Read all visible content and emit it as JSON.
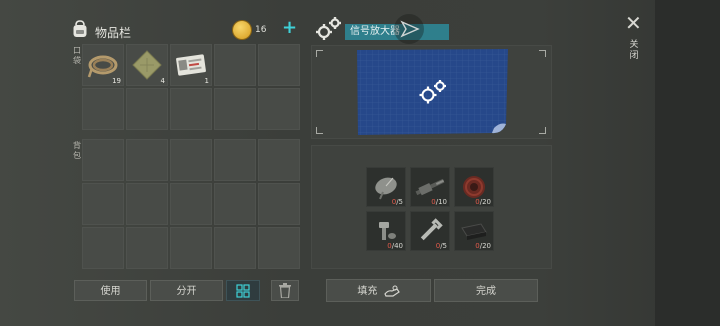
{
  "inventory": {
    "title": "物品栏",
    "coins": "16",
    "plus": "+",
    "pocket_label": "口袋",
    "backpack_label": "背包",
    "items": [
      {
        "name": "rope",
        "qty": "19"
      },
      {
        "name": "cloth",
        "qty": "4"
      },
      {
        "name": "card",
        "qty": "1"
      }
    ]
  },
  "buttons": {
    "use": "使用",
    "split": "分开",
    "fill": "填充",
    "done": "完成"
  },
  "craft": {
    "name": "信号放大器",
    "materials": [
      {
        "icon": "satellite-dish-icon",
        "have": "0",
        "need": "/5"
      },
      {
        "icon": "rifle-part-icon",
        "have": "0",
        "need": "/10"
      },
      {
        "icon": "wire-spool-icon",
        "have": "0",
        "need": "/20"
      },
      {
        "icon": "bolt-icon",
        "have": "0",
        "need": "/40"
      },
      {
        "icon": "wrench-icon",
        "have": "0",
        "need": "/5"
      },
      {
        "icon": "rubber-icon",
        "have": "0",
        "need": "/20"
      }
    ]
  },
  "close": {
    "symbol": "✕",
    "label": "关闭"
  },
  "colors": {
    "accent": "#3fd1d8",
    "missing": "#e25b4b",
    "tag": "#2f7f8c"
  }
}
